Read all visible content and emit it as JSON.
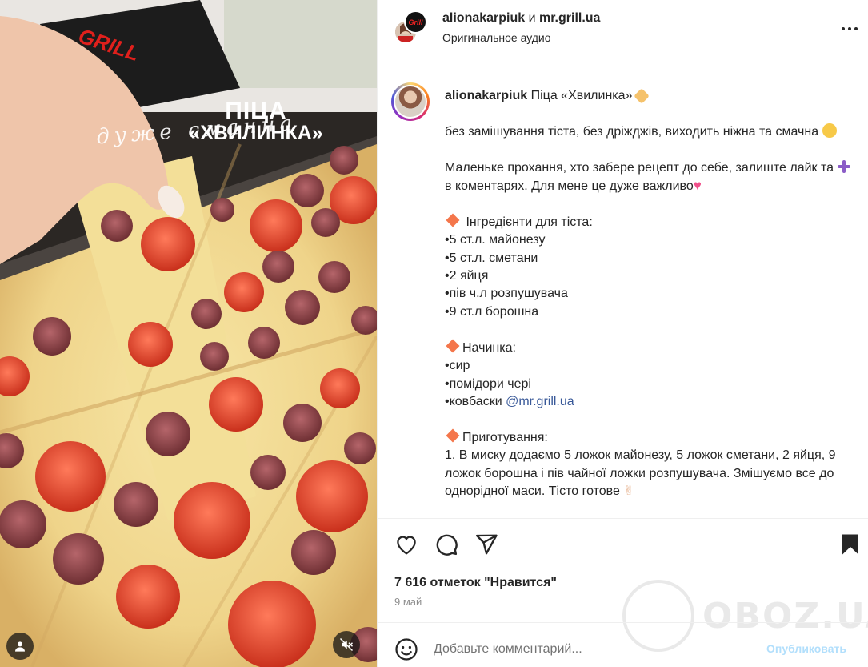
{
  "media": {
    "overlay_title_line1": "ПІЦА",
    "overlay_title_line2": "дуже смачна",
    "overlay_title_line3": "«ХВИЛИНКА»",
    "box_brand": "GRILL"
  },
  "header": {
    "author1": "alionakarpiuk",
    "conjunction": " и ",
    "author2": "mr.grill.ua",
    "audio": "Оригинальное аудио",
    "avatar2_text": "Grill"
  },
  "caption": {
    "username": "alionakarpiuk",
    "title": " Піца «Хвилинка» ",
    "p1": "без замішування тіста, без дріжджів, виходить ніжна та смачна ",
    "p2a": "Маленьке прохання, хто забере рецепт до себе, залиште лайк та ",
    "p2b": " в коментарях. Для мене це дуже важливо",
    "ingredients_heading": "Інгредієнти для тіста:",
    "ingredients": [
      "•5 ст.л. майонезу",
      "•5 ст.л. сметани",
      "•2 яйця",
      "•пів ч.л розпушувача",
      "•9 ст.л борошна"
    ],
    "filling_heading": "Начинка:",
    "filling": [
      "•сир",
      "•помідори чері"
    ],
    "filling_last_prefix": "•ковбаски ",
    "filling_mention": "@mr.grill.ua",
    "prep_heading": "Приготування:",
    "prep_text": "1. В миску додаємо 5 ложок майонезу, 5 ложок сметани, 2 яйця, 9 ложок борошна і пів чайної ложки розпушувача. Змішуємо все до однорідної маси. Тісто готове "
  },
  "actions": {
    "likes": "7 616 отметок \"Нравится\"",
    "date": "9 май"
  },
  "comment": {
    "placeholder": "Добавьте комментарий...",
    "post": "Опубликовать"
  },
  "watermark": {
    "text": "OBOZ.UA"
  },
  "icons": [
    "heart-icon",
    "comment-icon",
    "share-icon",
    "bookmark-icon",
    "more-icon",
    "emoji-icon",
    "mute-icon",
    "user-tag-icon"
  ]
}
